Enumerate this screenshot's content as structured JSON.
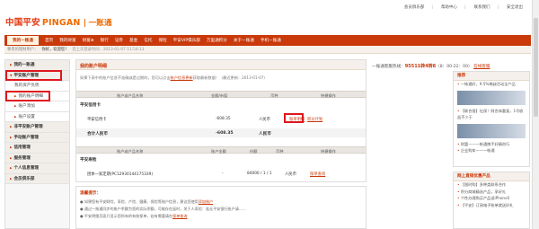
{
  "brand": {
    "logo_cn": "中国平安",
    "logo_en": "PINGAN",
    "logo_sub": "一账通"
  },
  "top_links": [
    "会员俱乐部",
    "帮助中心",
    "联系我们",
    "安全退出"
  ],
  "nav": {
    "items": [
      "我的一账通",
      "首页",
      "我的财富",
      "财富⊕",
      "银行",
      "证券",
      "基金",
      "信托",
      "保险",
      "平安VIP俱乐部",
      "万里通积分",
      "关于一账通",
      "手机一账通"
    ]
  },
  "subnav": {
    "prefix": "尊贵的理财用户：",
    "user": "你好，欢迎您！",
    "time": "您上次登录时间：2013-01-07 11:54:13"
  },
  "sidebar": {
    "items": [
      {
        "label": "我的一账通",
        "type": "head"
      },
      {
        "label": "平安账户管理",
        "type": "head"
      },
      {
        "label": "我的资产负债",
        "type": "sub"
      },
      {
        "label": "我的账户明细",
        "type": "sub"
      },
      {
        "label": "账户添加",
        "type": "sub"
      },
      {
        "label": "账户设置",
        "type": "sub"
      },
      {
        "label": "非平安账户管理",
        "type": "head"
      },
      {
        "label": "手动账户管理",
        "type": "head"
      },
      {
        "label": "信用管理",
        "type": "head"
      },
      {
        "label": "服务管理",
        "type": "head"
      },
      {
        "label": "个人信息管理",
        "type": "head"
      },
      {
        "label": "会员俱乐部",
        "type": "head"
      }
    ]
  },
  "main": {
    "title": "我的账户明细",
    "notice": {
      "text": "如果下表中的账户信息不准确或是过期的，您可以点击",
      "link": "账户信息更新",
      "text2": "获取最新数据！（最近更新：2013-01-07）"
    },
    "table1": {
      "headers": [
        "账户或产品名称",
        "金额/市值",
        "币种",
        "快捷操作"
      ],
      "section": "平安信用卡",
      "row": {
        "name": "平安信用卡",
        "amount": "-608.35",
        "currency": "人民币",
        "action1": "账单明细",
        "action2": "积分计划"
      },
      "total": {
        "label": "合计人民币",
        "amount": "-608.35",
        "currency": "人民币"
      }
    },
    "table2": {
      "headers": [
        "账户或产品名称",
        "账户金额",
        "份额",
        "币种",
        "快捷操作"
      ],
      "section": "平安寿险",
      "row": {
        "name": "团体一家定期(PC12930144175339)",
        "amount": "-",
        "share": "84000 / 1 / 1",
        "currency": "人民币",
        "action": "保单查询"
      }
    },
    "tips": {
      "title": "温馨提示：",
      "lines": [
        {
          "text": "如果您有平安财险、寿险、产险、健康、保险等账户信息，建议您使用",
          "link": "添加账户"
        },
        {
          "text": "通过一账通同步的账户余额为您的实际余额，可能存在延时，关于人寿险：若无平安银行账户请……",
          "link": ""
        },
        {
          "text": "平安明细页面只显示您所有的有效保单，若有需要请在",
          "link": "保单查询"
        }
      ]
    }
  },
  "right": {
    "phone_label": "一账通客服热线：",
    "phone": "95511转4转8",
    "phone_hours": "（8：00-22：00）",
    "phone_link": "在线客服",
    "promo": {
      "title": "推荐",
      "items": [
        "一帐通好，9.5%稀缺活动全产品",
        "【联合银】社保！财合体重复，1号收益不少于",
        "财富——一帐通携手好精尚行",
        "企业购车——一帐通"
      ]
    },
    "products": {
      "title": "网上直销优惠产品",
      "items": [
        "【限时购】多种类联系合作",
        "积分商城精选产品，享好礼",
        "个性办理购买产品送iPhone5",
        "【平安】订阅电子账单就送好礼"
      ]
    }
  }
}
